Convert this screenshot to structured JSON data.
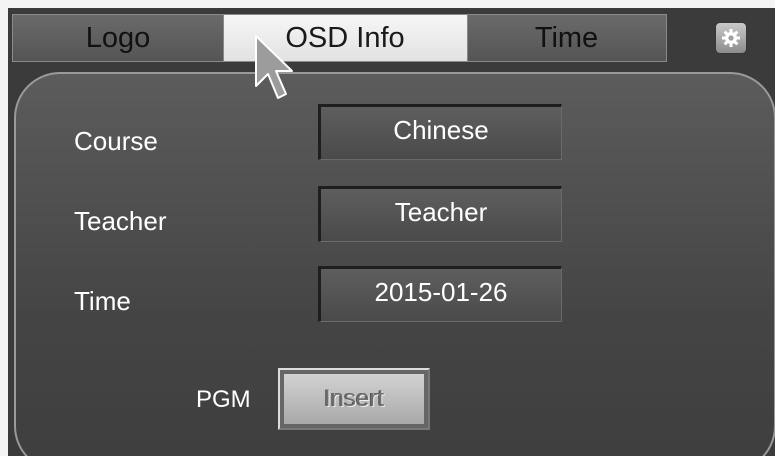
{
  "tabs": {
    "logo": "Logo",
    "osd_info": "OSD Info",
    "time": "Time"
  },
  "settings_icon": "gear-icon",
  "form": {
    "course_label": "Course",
    "course_value": "Chinese",
    "teacher_label": "Teacher",
    "teacher_value": "Teacher",
    "time_label": "Time",
    "time_value": "2015-01-26"
  },
  "pgm": {
    "label": "PGM",
    "button_label": "Insert"
  },
  "colors": {
    "background": "#3b3b3b",
    "active_tab": "#e8e8e8",
    "panel": "#4c4c4c"
  }
}
